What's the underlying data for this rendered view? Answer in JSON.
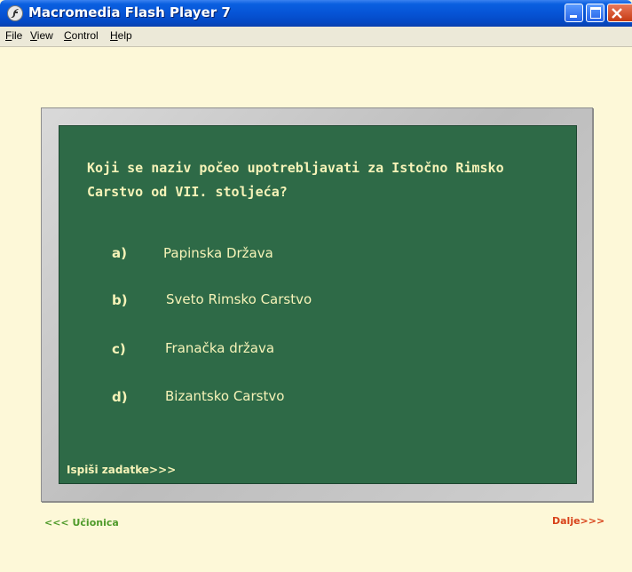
{
  "window": {
    "title": "Macromedia Flash Player 7",
    "app_icon": "flash-player-icon"
  },
  "menu": [
    {
      "label": "File",
      "accel": "F"
    },
    {
      "label": "View",
      "accel": "V"
    },
    {
      "label": "Control",
      "accel": "C"
    },
    {
      "label": "Help",
      "accel": "H"
    }
  ],
  "quiz": {
    "question": "Koji se naziv počeo upotrebljavati za Istočno Rimsko Carstvo od VII. stoljeća?",
    "options": [
      {
        "letter": "a)",
        "text": "Papinska Država"
      },
      {
        "letter": "b)",
        "text": "Sveto Rimsko Carstvo"
      },
      {
        "letter": "c)",
        "text": "Franačka država"
      },
      {
        "letter": "d)",
        "text": "Bizantsko Carstvo"
      }
    ],
    "print_link": "Ispiši zadatke>>>"
  },
  "nav": {
    "back": "<<< Učionica",
    "next": "Dalje>>>"
  },
  "colors": {
    "board": "#2e6a47",
    "chalk_text": "#f6f3b8",
    "back_link": "#4e9a2a",
    "next_link": "#d8421a",
    "stage_bg": "#fdf8d8"
  }
}
